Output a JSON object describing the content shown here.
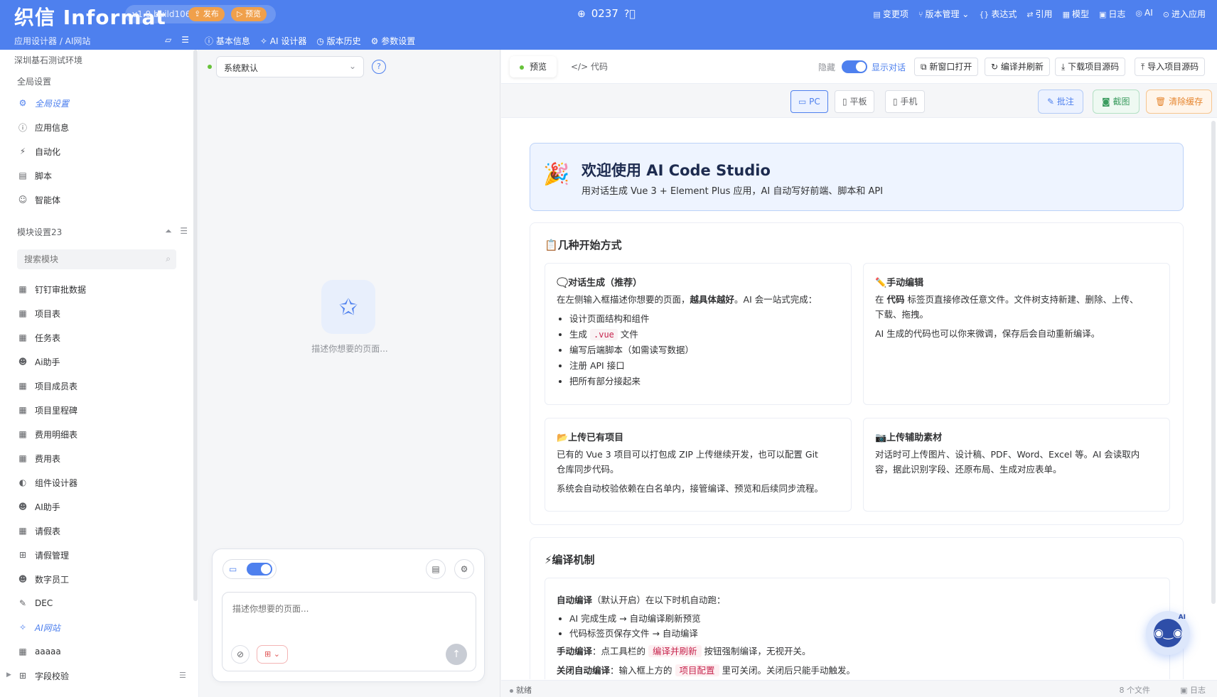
{
  "topbar": {
    "logo": "织信 Informat",
    "version": "v1.0 build106",
    "publish": "发布",
    "preview": "预览",
    "count": "0237",
    "actions": [
      {
        "icon": "▤",
        "label": "变更项"
      },
      {
        "icon": "⑂",
        "label": "版本管理 ⌄"
      },
      {
        "icon": "{}",
        "label": "表达式"
      },
      {
        "icon": "⇄",
        "label": "引用"
      },
      {
        "icon": "▦",
        "label": "模型"
      },
      {
        "icon": "▣",
        "label": "日志"
      },
      {
        "icon": "◎",
        "label": "AI"
      },
      {
        "icon": "⊙",
        "label": "进入应用"
      }
    ],
    "breadcrumb": "应用设计器 / AI网站",
    "subtabs": [
      {
        "icon": "ⓘ",
        "label": "基本信息"
      },
      {
        "icon": "✧",
        "label": "AI 设计器"
      },
      {
        "icon": "◷",
        "label": "版本历史"
      },
      {
        "icon": "⚙",
        "label": "参数设置"
      }
    ]
  },
  "sidebar": {
    "env": "深圳基石测试环境",
    "global_title": "全局设置",
    "global_items": [
      {
        "icon": "⚙",
        "label": "全局设置"
      },
      {
        "icon": "ⓘ",
        "label": "应用信息"
      },
      {
        "icon": "⚡",
        "label": "自动化"
      },
      {
        "icon": "▤",
        "label": "脚本"
      },
      {
        "icon": "☺",
        "label": "智能体"
      }
    ],
    "module_title": "模块设置23",
    "search_placeholder": "搜索模块",
    "modules": [
      {
        "icon": "▦",
        "label": "钉钉审批数据"
      },
      {
        "icon": "▦",
        "label": "项目表"
      },
      {
        "icon": "▦",
        "label": "任务表"
      },
      {
        "icon": "☻",
        "label": "Ai助手"
      },
      {
        "icon": "▦",
        "label": "项目成员表"
      },
      {
        "icon": "▦",
        "label": "项目里程碑"
      },
      {
        "icon": "▦",
        "label": "费用明细表"
      },
      {
        "icon": "▦",
        "label": "费用表"
      },
      {
        "icon": "◐",
        "label": "组件设计器"
      },
      {
        "icon": "☻",
        "label": "AI助手"
      },
      {
        "icon": "▦",
        "label": "请假表"
      },
      {
        "icon": "⊞",
        "label": "请假管理"
      },
      {
        "icon": "☻",
        "label": "数字员工"
      },
      {
        "icon": "✎",
        "label": "DEC"
      },
      {
        "icon": "✧",
        "label": "AI网站"
      },
      {
        "icon": "▦",
        "label": "aaaaa"
      },
      {
        "icon": "⊞",
        "label": "字段校验"
      }
    ]
  },
  "chat": {
    "model": "系统默认",
    "empty_text": "描述你想要的页面...",
    "input_placeholder": "描述你想要的页面..."
  },
  "preview": {
    "tabs": [
      {
        "label": "预览"
      },
      {
        "label": "代码"
      }
    ],
    "hide_label": "隐藏",
    "show_label": "显示对话",
    "tools": [
      {
        "icon": "⧉",
        "label": "新窗口打开"
      },
      {
        "icon": "↻",
        "label": "编译并刷新"
      },
      {
        "icon": "⤓",
        "label": "下载项目源码"
      },
      {
        "icon": "⤒",
        "label": "导入项目源码"
      }
    ],
    "devices": [
      {
        "icon": "▭",
        "label": "PC"
      },
      {
        "icon": "▯",
        "label": "平板"
      },
      {
        "icon": "▯",
        "label": "手机"
      }
    ],
    "actions": [
      {
        "icon": "✎",
        "label": "批注"
      },
      {
        "icon": "◙",
        "label": "截图"
      },
      {
        "icon": "🗑",
        "label": "清除缓存"
      }
    ],
    "hero": {
      "title": "欢迎使用 AI Code Studio",
      "subtitle": "用对话生成 Vue 3 + Element Plus 应用，AI 自动写好前端、脚本和 API"
    },
    "ways": {
      "title": "📋几种开始方式",
      "chat_gen": {
        "title": "🗨️对话生成（推荐）",
        "intro_a": "在左侧输入框描述你想要的页面，",
        "intro_bold": "越具体越好",
        "intro_b": "。AI 会一站式完成：",
        "bullets": [
          "设计页面结构和组件",
          "生成",
          "文件",
          "编写后端脚本（如需读写数据）",
          "注册 API 接口",
          "把所有部分接起来"
        ],
        "code": ".vue"
      },
      "manual": {
        "title": "✏️手动编辑",
        "p1_a": "在 ",
        "p1_bold": "代码",
        "p1_b": " 标签页直接修改任意文件。文件树支持新建、删除、上传、",
        "p1_c": "下载、拖拽。",
        "p2": "AI 生成的代码也可以你来微调，保存后会自动重新编译。"
      },
      "upload": {
        "title": "📂上传已有项目",
        "p1": "已有的 Vue 3 项目可以打包成 ZIP 上传继续开发，也可以配置 Git",
        "p1b": "仓库同步代码。",
        "p2": "系统会自动校验依赖在白名单内，接管编译、预览和后续同步流程。"
      },
      "assets": {
        "title": "📷上传辅助素材",
        "p1": "对话时可上传图片、设计稿、PDF、Word、Excel 等。AI 会读取内",
        "p1b": "容，据此识别字段、还原布局、生成对应表单。"
      }
    },
    "compile": {
      "title": "⚡编译机制",
      "auto_bold": "自动编译",
      "auto_rest": "（默认开启）在以下时机自动跑：",
      "b1": "AI 完成生成 → 自动编译刷新预览",
      "b2": "代码标签页保存文件 → 自动编译",
      "manual_bold": "手动编译",
      "manual_a": "：点工具栏的 ",
      "manual_tag": "编译并刷新",
      "manual_b": " 按钮强制编译，无视开关。",
      "close_bold": "关闭自动编译",
      "close_a": "：输入框上方的 ",
      "close_tag": "项目配置",
      "close_b": " 里可关闭。关闭后只能手动触发。"
    },
    "status": {
      "left": "就绪",
      "files": "8 个文件",
      "log": "日志"
    }
  }
}
